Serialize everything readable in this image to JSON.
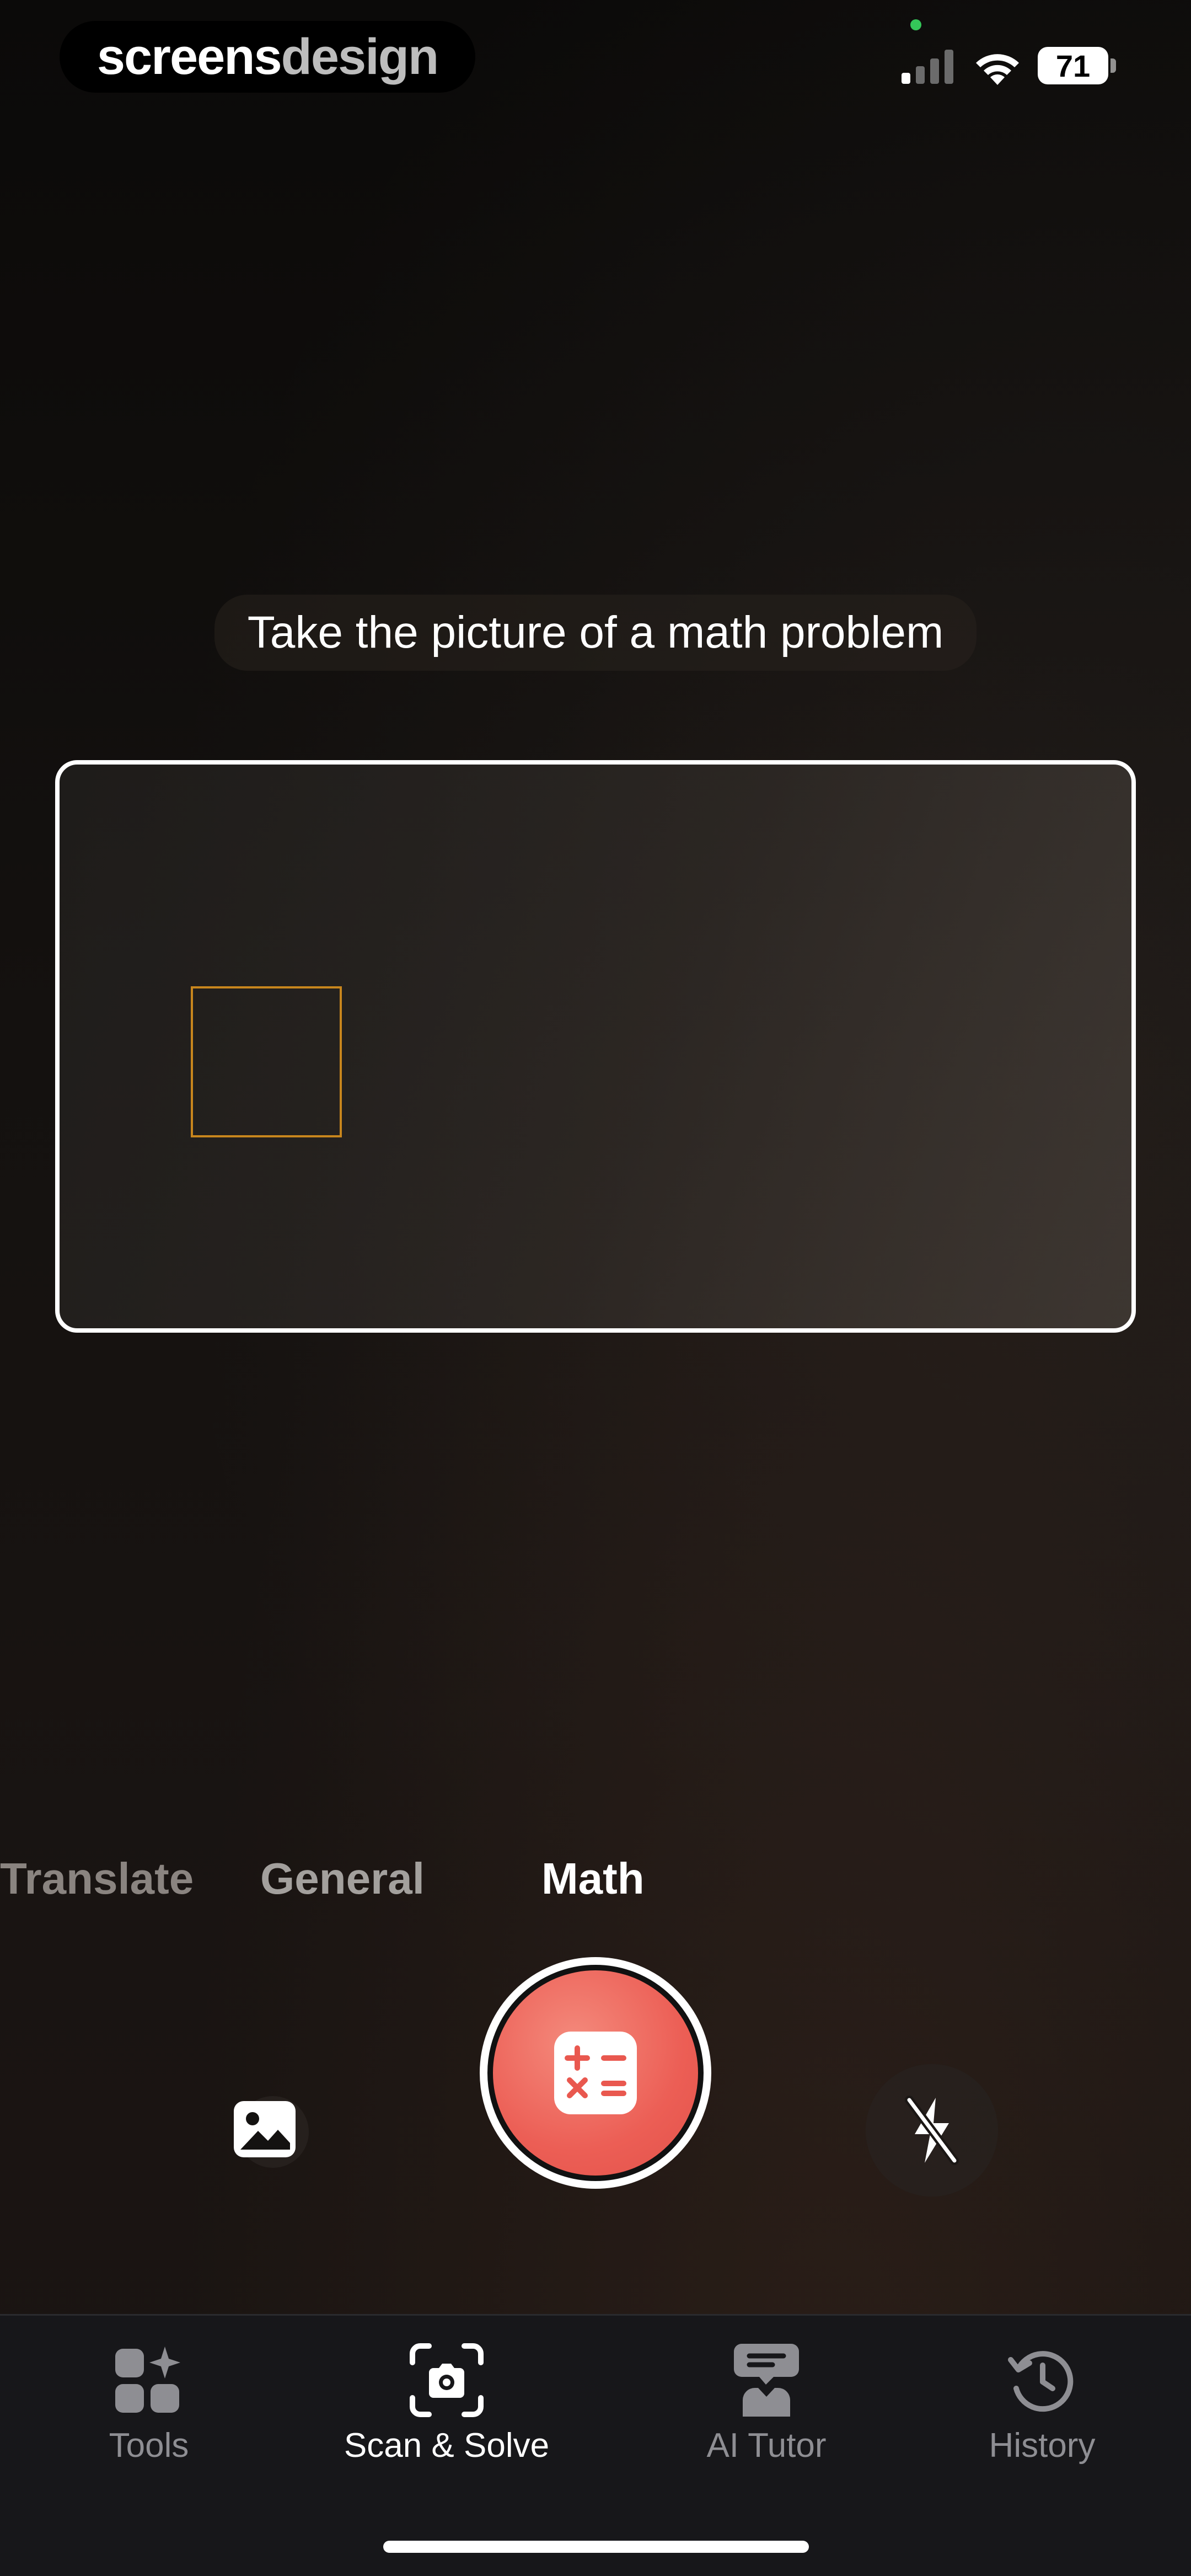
{
  "watermark": {
    "brand_bold": "screens",
    "brand_light": "design"
  },
  "status_bar": {
    "battery": "71"
  },
  "instruction": "Take the picture of a math problem",
  "modes": [
    {
      "label": "Translate"
    },
    {
      "label": "General"
    },
    {
      "label": "Math",
      "selected": true
    }
  ],
  "controls": {
    "gallery_icon": "image-icon",
    "shutter_icon": "calculator-icon",
    "flash_icon": "flash-off-icon"
  },
  "tabs": [
    {
      "label": "Tools",
      "icon": "tools-grid-icon"
    },
    {
      "label": "Scan & Solve",
      "icon": "camera-scan-icon",
      "active": true
    },
    {
      "label": "AI Tutor",
      "icon": "tutor-icon"
    },
    {
      "label": "History",
      "icon": "history-icon"
    }
  ],
  "colors": {
    "accent": "#ec5e55",
    "focus": "#c8861d",
    "tab_inactive": "#8e8e93"
  }
}
